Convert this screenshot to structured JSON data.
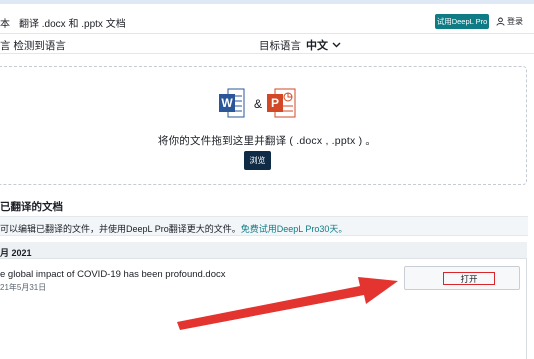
{
  "header": {
    "tab_partial": "本",
    "tab_docs": "翻译 .docx 和 .pptx 文档",
    "try_button": "试用DeepL Pro",
    "login": "登录"
  },
  "langbar": {
    "source": "言 检测到语言",
    "target_label": "目标语言",
    "target_value": "中文"
  },
  "upload": {
    "word_letter": "W",
    "ampersand": "&",
    "ppt_letter": "P",
    "drop_text": "将你的文件拖到这里并翻译 ( .docx , .pptx ) 。",
    "browse_button": "浏览"
  },
  "translated": {
    "title": "已翻译的文档",
    "banner_text": "可以编辑已翻译的文件，并使用DeepL Pro翻译更大的文件。",
    "banner_link": "免费试用DeepL Pro30天。",
    "group_header": "月 2021",
    "document": {
      "name": "e global impact of COVID-19 has been profound.docx",
      "date": "21年5月31日",
      "open_button": "打开"
    }
  },
  "colors": {
    "accent": "#0f7b84",
    "dark": "#0f2b46",
    "word": "#2b579a",
    "ppt": "#d24726",
    "annotation": "#e3342f"
  }
}
